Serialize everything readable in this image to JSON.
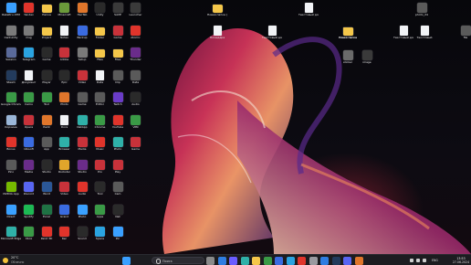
{
  "taskbar": {
    "weather": {
      "temp": "20°C",
      "condition": "Облачно"
    },
    "search_label": "Поиск",
    "apps": [
      {
        "name": "start-icon",
        "color": "#3aa0ff"
      },
      {
        "name": "search-app-icon",
        "color": "#d0d0d0"
      },
      {
        "name": "task-view-icon",
        "color": "#8a8a8a"
      },
      {
        "name": "widgets-icon",
        "color": "#2f7de1"
      },
      {
        "name": "chat-icon",
        "color": "#6a5cff"
      },
      {
        "name": "edge-icon",
        "color": "#2fb0a8"
      },
      {
        "name": "file-explorer-icon",
        "color": "#f4c74a"
      },
      {
        "name": "chrome-icon",
        "color": "#3a9a46"
      },
      {
        "name": "store-icon",
        "color": "#3a6be0"
      },
      {
        "name": "telegram-icon",
        "color": "#2aa3e0"
      },
      {
        "name": "yandex-icon",
        "color": "#e0342b"
      },
      {
        "name": "settings-icon",
        "color": "#9a9aa0"
      },
      {
        "name": "mail-icon",
        "color": "#2f7de1"
      },
      {
        "name": "steam-icon",
        "color": "#233b5c"
      },
      {
        "name": "discord-icon",
        "color": "#5865f2"
      },
      {
        "name": "media-icon",
        "color": "#e0762b"
      }
    ],
    "tray": {
      "language": "ENG",
      "time": "13:53",
      "date": "27.06.2024"
    }
  },
  "desktop": {
    "columns": [
      {
        "items": [
          {
            "label": "Rakeltru ATM",
            "kind": "app",
            "color": "#3aa0ff"
          },
          {
            "label": "CentuCity",
            "kind": "app",
            "color": "#7a7a7a"
          },
          {
            "label": "Session",
            "kind": "app",
            "color": "#5a6a9a"
          },
          {
            "label": "Steam",
            "kind": "app",
            "color": "#233b5c"
          },
          {
            "label": "Google Chrome",
            "kind": "app",
            "color": "#3a9a46"
          },
          {
            "label": "Корзина",
            "kind": "app",
            "color": "#9ab6d8"
          },
          {
            "label": "Bonus",
            "kind": "app",
            "color": "#e0342b"
          },
          {
            "label": "Pico",
            "kind": "app",
            "color": "#5a5a5a"
          },
          {
            "label": "NVIDIA App",
            "kind": "app",
            "color": "#76b900"
          },
          {
            "label": "Direct",
            "kind": "app",
            "color": "#3aa0ff"
          },
          {
            "label": "Microsoft Edge",
            "kind": "app",
            "color": "#2fb0a8"
          }
        ]
      },
      {
        "items": [
          {
            "label": "Yandex",
            "kind": "app",
            "color": "#e0342b"
          },
          {
            "label": "msg",
            "kind": "app",
            "color": "#7a7a7a"
          },
          {
            "label": "Telegram",
            "kind": "app",
            "color": "#2aa3e0"
          },
          {
            "label": "Документ",
            "kind": "doc",
            "color": "#f1f3f6"
          },
          {
            "label": "Cemu",
            "kind": "app",
            "color": "#3a9a46"
          },
          {
            "label": "Opera",
            "kind": "app",
            "color": "#c8323a"
          },
          {
            "label": "Ubisoft",
            "kind": "app",
            "color": "#3a6be0"
          },
          {
            "label": "Media",
            "kind": "app",
            "color": "#6a2c8a"
          },
          {
            "label": "Discord",
            "kind": "app",
            "color": "#5865f2"
          },
          {
            "label": "Spotify",
            "kind": "app",
            "color": "#1db954"
          },
          {
            "label": "Xbox",
            "kind": "app",
            "color": "#3a9a46"
          }
        ]
      },
      {
        "items": [
          {
            "label": "Папка",
            "kind": "folder",
            "color": "#f4c74a"
          },
          {
            "label": "Project",
            "kind": "folder",
            "color": "#f4c74a"
          },
          {
            "label": "Game",
            "kind": "app",
            "color": "#2a2a2a"
          },
          {
            "label": "Player",
            "kind": "app",
            "color": "#2a2a2a"
          },
          {
            "label": "Tool",
            "kind": "app",
            "color": "#3a9a46"
          },
          {
            "label": "Paint",
            "kind": "app",
            "color": "#e0762b"
          },
          {
            "label": "App",
            "kind": "app",
            "color": "#5a5a5a"
          },
          {
            "label": "Studio",
            "kind": "app",
            "color": "#2a2a2a"
          },
          {
            "label": "Word",
            "kind": "app",
            "color": "#2b5797"
          },
          {
            "label": "Excel",
            "kind": "app",
            "color": "#1f7244"
          },
          {
            "label": "Paint 3D",
            "kind": "app",
            "color": "#e0342b"
          }
        ]
      },
      {
        "items": [
          {
            "label": "Minecraft",
            "kind": "app",
            "color": "#6a9a3a"
          },
          {
            "label": "Notes",
            "kind": "doc",
            "color": "#f1f3f6"
          },
          {
            "label": "Adobe",
            "kind": "app",
            "color": "#c8323a"
          },
          {
            "label": "Epic",
            "kind": "app",
            "color": "#2a2a2a"
          },
          {
            "label": "Photo",
            "kind": "app",
            "color": "#e0762b"
          },
          {
            "label": "Docs",
            "kind": "doc",
            "color": "#f1f3f6"
          },
          {
            "label": "Browser",
            "kind": "app",
            "color": "#2fb0a8"
          },
          {
            "label": "Rockstar",
            "kind": "app",
            "color": "#e0a52b"
          },
          {
            "label": "Video",
            "kind": "app",
            "color": "#c8323a"
          },
          {
            "label": "Grand",
            "kind": "app",
            "color": "#3a6be0"
          },
          {
            "label": "Rec",
            "kind": "app",
            "color": "#e0342b"
          }
        ]
      },
      {
        "items": [
          {
            "label": "HacTab",
            "kind": "app",
            "color": "#e0762b"
          },
          {
            "label": "Backup",
            "kind": "app",
            "color": "#3a6be0"
          },
          {
            "label": "Setup",
            "kind": "app",
            "color": "#7a7a7a"
          },
          {
            "label": "Video",
            "kind": "app",
            "color": "#c8323a"
          },
          {
            "label": "Game",
            "kind": "app",
            "color": "#5a5a5a"
          },
          {
            "label": "NetApp",
            "kind": "app",
            "color": "#2fb0a8"
          },
          {
            "label": "Media",
            "kind": "app",
            "color": "#c8323a"
          },
          {
            "label": "Studio",
            "kind": "app",
            "color": "#6a2c8a"
          },
          {
            "label": "Audio",
            "kind": "app",
            "color": "#e0342b"
          },
          {
            "label": "Photo",
            "kind": "app",
            "color": "#3aa0ff"
          },
          {
            "label": "Sound",
            "kind": "app",
            "color": "#2a2a2a"
          }
        ]
      },
      {
        "items": [
          {
            "label": "Unity",
            "kind": "app",
            "color": "#2a2a2a"
          },
          {
            "label": "Folder",
            "kind": "folder",
            "color": "#f4c74a"
          },
          {
            "label": "Files",
            "kind": "folder",
            "color": "#f4c74a"
          },
          {
            "label": "Data",
            "kind": "doc",
            "color": "#f1f3f6"
          },
          {
            "label": "Editor",
            "kind": "app",
            "color": "#5a5a5a"
          },
          {
            "label": "Chrome",
            "kind": "app",
            "color": "#3a9a46"
          },
          {
            "label": "Music",
            "kind": "app",
            "color": "#e0342b"
          },
          {
            "label": "Pro",
            "kind": "app",
            "color": "#c8323a"
          },
          {
            "label": "Tool",
            "kind": "app",
            "color": "#2a2a2a"
          },
          {
            "label": "Apps",
            "kind": "app",
            "color": "#3a9a46"
          },
          {
            "label": "Space",
            "kind": "app",
            "color": "#2aa3e0"
          }
        ]
      },
      {
        "items": [
          {
            "label": "SAVE",
            "kind": "app",
            "color": "#3a3a3a"
          },
          {
            "label": "Game",
            "kind": "app",
            "color": "#c8323a"
          },
          {
            "label": "Files",
            "kind": "folder",
            "color": "#f4c74a"
          },
          {
            "label": "Clip",
            "kind": "app",
            "color": "#5a5a5a"
          },
          {
            "label": "Twitch",
            "kind": "app",
            "color": "#6a3cc8"
          },
          {
            "label": "YouTube",
            "kind": "app",
            "color": "#e0342b"
          },
          {
            "label": "Photo",
            "kind": "app",
            "color": "#2fb0a8"
          },
          {
            "label": "Play",
            "kind": "app",
            "color": "#c8323a"
          },
          {
            "label": "Cam",
            "kind": "app",
            "color": "#5a5a5a"
          },
          {
            "label": "Net",
            "kind": "app",
            "color": "#2a2a2a"
          },
          {
            "label": "Pic",
            "kind": "app",
            "color": "#3aa0ff"
          }
        ]
      },
      {
        "items": [
          {
            "label": "Launcher",
            "kind": "app",
            "color": "#3a3a3a"
          },
          {
            "label": "Atomic",
            "kind": "app",
            "color": "#e0342b"
          },
          {
            "label": "Thunder",
            "kind": "app",
            "color": "#6a2c8a"
          },
          {
            "label": "Data",
            "kind": "app",
            "color": "#5a5a5a"
          },
          {
            "label": "Audio",
            "kind": "app",
            "color": "#2a2a2a"
          },
          {
            "label": "VPN",
            "kind": "app",
            "color": "#3a9a46"
          },
          {
            "label": "Game",
            "kind": "app",
            "color": "#c8323a"
          }
        ]
      }
    ],
    "right_items": [
      {
        "label": "Новая папка (2)",
        "kind": "folder",
        "color": "#f4c74a"
      },
      {
        "label": "Текстовый документ",
        "kind": "doc",
        "color": "#f1f3f6"
      },
      {
        "label": "Новая папка",
        "kind": "folder",
        "color": "#f4c74a"
      },
      {
        "label": "photo_24",
        "kind": "app",
        "color": "#5a5a5a"
      },
      {
        "label": "Площадка",
        "kind": "doc",
        "color": "#f1f3f6"
      },
      {
        "label": "Текстовый документ",
        "kind": "doc",
        "color": "#f1f3f6"
      },
      {
        "label": "Новая папка",
        "kind": "folder",
        "color": "#f4c74a"
      },
      {
        "label": "Текстовый документ (2)",
        "kind": "doc",
        "color": "#f1f3f6"
      },
      {
        "label": "Текстовый",
        "kind": "doc",
        "color": "#f1f3f6"
      },
      {
        "label": "sticker",
        "kind": "app",
        "color": "#6a6a6a"
      },
      {
        "label": "image",
        "kind": "app",
        "color": "#3a3a3a"
      },
      {
        "label": "file",
        "kind": "app",
        "color": "#5a5a5a"
      }
    ]
  }
}
